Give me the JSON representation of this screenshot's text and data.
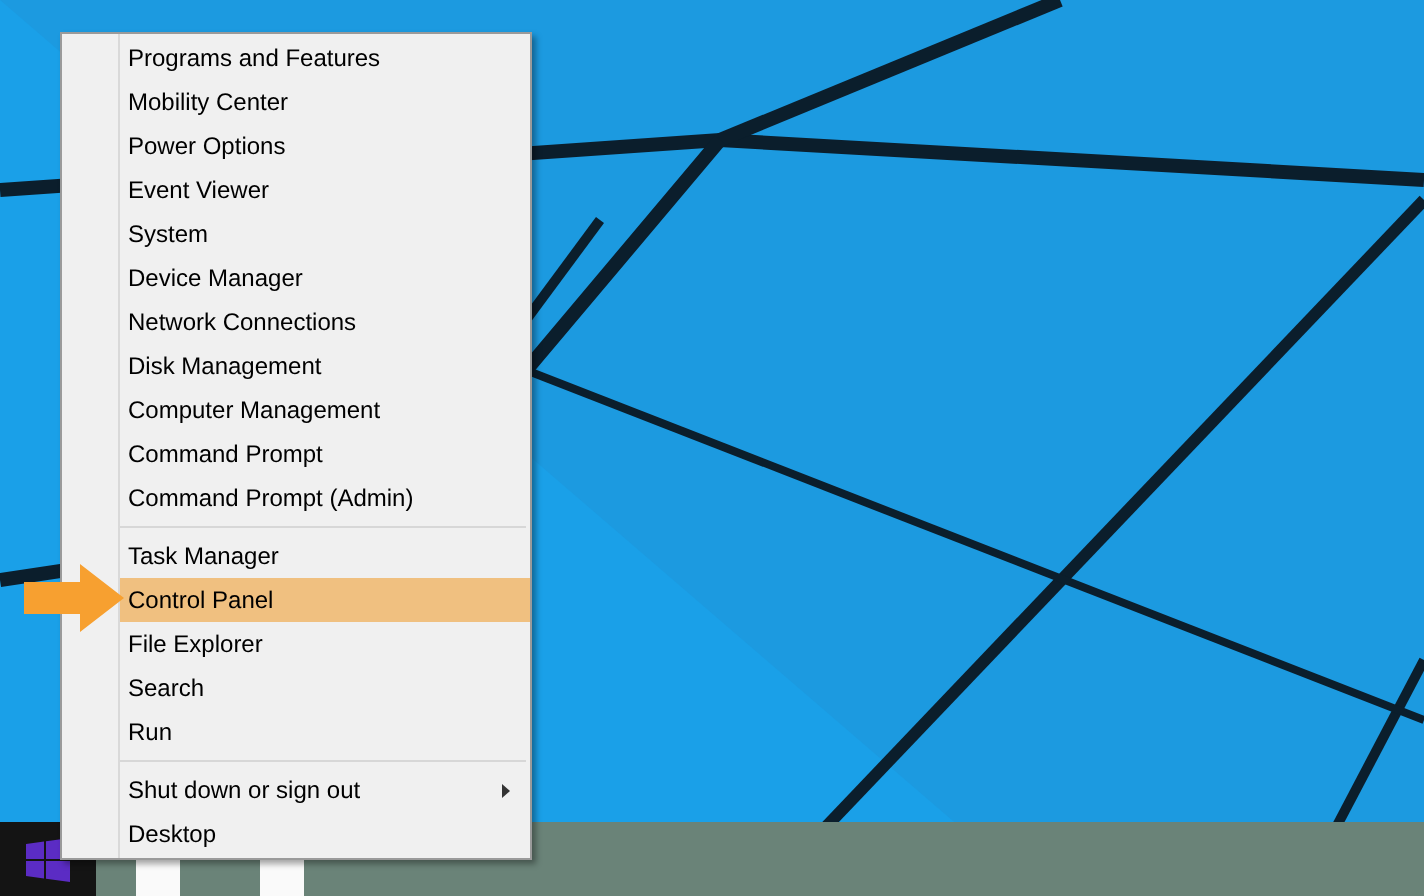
{
  "context_menu": {
    "groups": [
      {
        "items": [
          {
            "label": "Programs and Features",
            "selected": false,
            "has_submenu": false
          },
          {
            "label": "Mobility Center",
            "selected": false,
            "has_submenu": false
          },
          {
            "label": "Power Options",
            "selected": false,
            "has_submenu": false
          },
          {
            "label": "Event Viewer",
            "selected": false,
            "has_submenu": false
          },
          {
            "label": "System",
            "selected": false,
            "has_submenu": false
          },
          {
            "label": "Device Manager",
            "selected": false,
            "has_submenu": false
          },
          {
            "label": "Network Connections",
            "selected": false,
            "has_submenu": false
          },
          {
            "label": "Disk Management",
            "selected": false,
            "has_submenu": false
          },
          {
            "label": "Computer Management",
            "selected": false,
            "has_submenu": false
          },
          {
            "label": "Command Prompt",
            "selected": false,
            "has_submenu": false
          },
          {
            "label": "Command Prompt (Admin)",
            "selected": false,
            "has_submenu": false
          }
        ]
      },
      {
        "items": [
          {
            "label": "Task Manager",
            "selected": false,
            "has_submenu": false
          },
          {
            "label": "Control Panel",
            "selected": true,
            "has_submenu": false
          },
          {
            "label": "File Explorer",
            "selected": false,
            "has_submenu": false
          },
          {
            "label": "Search",
            "selected": false,
            "has_submenu": false
          },
          {
            "label": "Run",
            "selected": false,
            "has_submenu": false
          }
        ]
      },
      {
        "items": [
          {
            "label": "Shut down or sign out",
            "selected": false,
            "has_submenu": true
          },
          {
            "label": "Desktop",
            "selected": false,
            "has_submenu": false
          }
        ]
      }
    ]
  }
}
